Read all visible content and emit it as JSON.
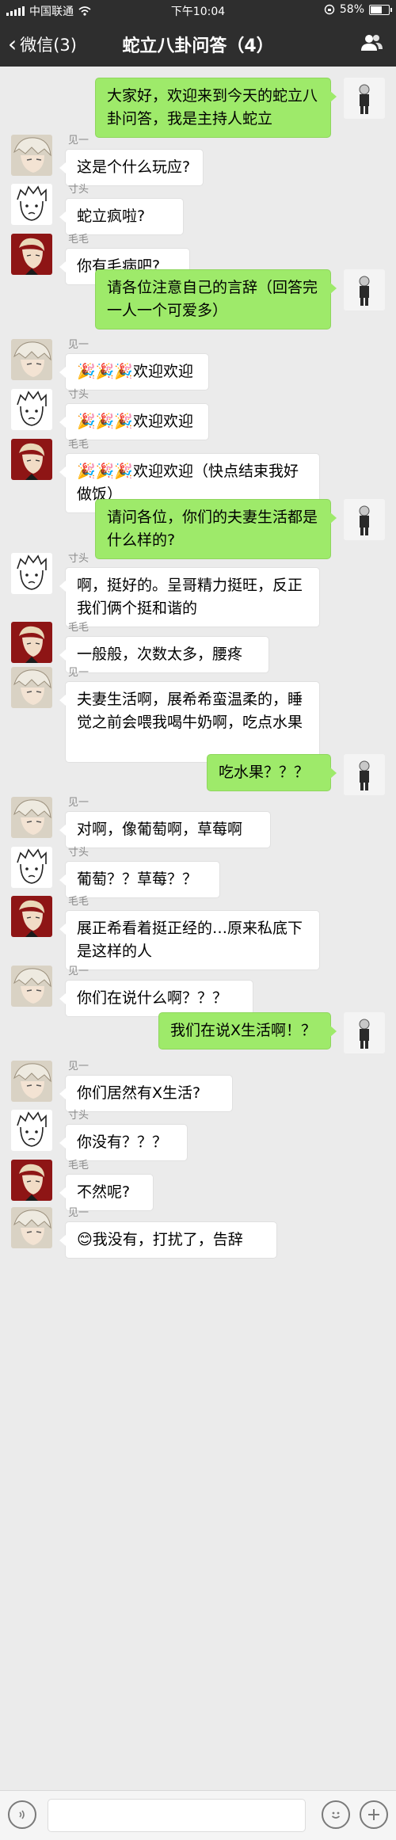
{
  "status": {
    "carrier": "中国联通",
    "time": "下午10:04",
    "battery": "58%"
  },
  "nav": {
    "back_label": "微信(3)",
    "title": "蛇立八卦问答（4）"
  },
  "messages": [
    {
      "side": "right",
      "avatar": "host",
      "name": "",
      "text": "大家好，欢迎来到今天的蛇立八卦问答，我是主持人蛇立"
    },
    {
      "side": "left",
      "avatar": "jianyi",
      "name": "见一",
      "text": "这是个什么玩应?"
    },
    {
      "side": "left",
      "avatar": "cuntou",
      "name": "寸头",
      "text": "蛇立疯啦?"
    },
    {
      "side": "left",
      "avatar": "maomao",
      "name": "毛毛",
      "text": "你有毛病吧?"
    },
    {
      "side": "right",
      "avatar": "host",
      "name": "",
      "text": "请各位注意自己的言辞（回答完一人一个可爱多）"
    },
    {
      "side": "left",
      "avatar": "jianyi",
      "name": "见一",
      "text": "🎉🎉🎉欢迎欢迎"
    },
    {
      "side": "left",
      "avatar": "cuntou",
      "name": "寸头",
      "text": "🎉🎉🎉欢迎欢迎"
    },
    {
      "side": "left",
      "avatar": "maomao",
      "name": "毛毛",
      "text": "🎉🎉🎉欢迎欢迎（快点结束我好做饭）"
    },
    {
      "side": "right",
      "avatar": "host",
      "name": "",
      "text": "请问各位，你们的夫妻生活都是什么样的?"
    },
    {
      "side": "left",
      "avatar": "cuntou",
      "name": "寸头",
      "text": "啊，挺好的。呈哥精力挺旺，反正我们俩个挺和谐的"
    },
    {
      "side": "left",
      "avatar": "maomao",
      "name": "毛毛",
      "text": "一般般，次数太多，腰疼"
    },
    {
      "side": "left",
      "avatar": "jianyi",
      "name": "见一",
      "text": "夫妻生活啊，展希希蛮温柔的，睡觉之前会喂我喝牛奶啊，吃点水果"
    },
    {
      "side": "right",
      "avatar": "host",
      "name": "",
      "text": "吃水果？？？"
    },
    {
      "side": "left",
      "avatar": "jianyi",
      "name": "见一",
      "text": "对啊，像葡萄啊，草莓啊"
    },
    {
      "side": "left",
      "avatar": "cuntou",
      "name": "寸头",
      "text": "葡萄？？草莓？？"
    },
    {
      "side": "left",
      "avatar": "maomao",
      "name": "毛毛",
      "text": "展正希看着挺正经的…原来私底下是这样的人"
    },
    {
      "side": "left",
      "avatar": "jianyi",
      "name": "见一",
      "text": "你们在说什么啊？？？"
    },
    {
      "side": "right",
      "avatar": "host",
      "name": "",
      "text": "我们在说X生活啊！？"
    },
    {
      "side": "left",
      "avatar": "jianyi",
      "name": "见一",
      "text": "你们居然有X生活?"
    },
    {
      "side": "left",
      "avatar": "cuntou",
      "name": "寸头",
      "text": "你没有？？？"
    },
    {
      "side": "left",
      "avatar": "maomao",
      "name": "毛毛",
      "text": "不然呢?"
    },
    {
      "side": "left",
      "avatar": "jianyi",
      "name": "见一",
      "text": "😊我没有，打扰了，告辞"
    }
  ]
}
